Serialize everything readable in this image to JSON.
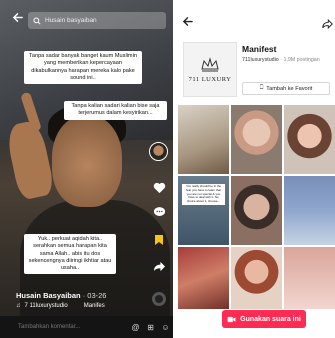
{
  "left": {
    "search_placeholder": "Husain basyaiban",
    "captions": [
      "Tanpa sadar banyak banget kaum Muslimin yang memberikan kepercayaan dikabulkannya harapan mereka kalo pake sound ini..",
      "Tanpa kalian sadari kalian bise saja terjerumus dalam kesyirikan...",
      "Yuk.. perkuat aqidah kita.. serahkan semua harapan kita sama Allah.. abis itu dos sekencengnya diiringi ikhtiar atau usaha.."
    ],
    "rail": {
      "like_count": "",
      "comment_count": "",
      "save_count": "",
      "share_count": ""
    },
    "author_name": "Husain Basyaiban",
    "author_date": "· 03-26",
    "music_label": "7 11luxurystudio",
    "music_label_2": "Manifes",
    "comment_placeholder": "Tambahkan komentar..."
  },
  "right": {
    "logo_text": "711 LUXURY",
    "sound_title": "Manifest",
    "sound_user": "711luxurystudio",
    "sound_count": "· 1,9M postingan",
    "favorite_label": "Tambah ke Favorit",
    "video_captions": [
      "You really should be in the fear you have to learn that you are not special & you have to deal with it. No choice about it, choose...",
      "",
      ""
    ],
    "use_sound_label": "Gunakan suara ini"
  },
  "colors": {
    "accent": "#fe2c55",
    "save_yellow": "#f7c21b"
  }
}
